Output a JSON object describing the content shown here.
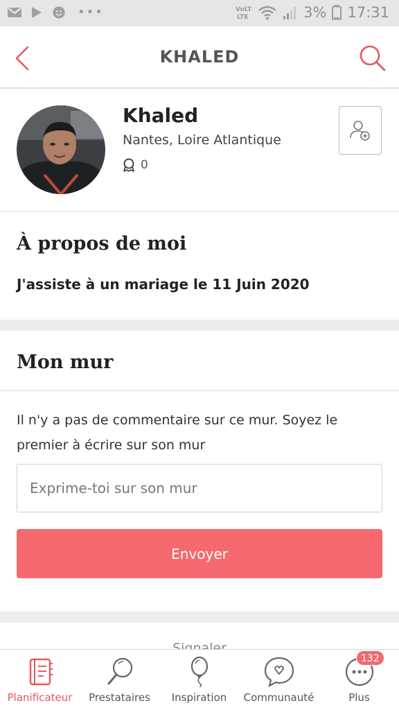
{
  "status_bar": {
    "battery": "3%",
    "time": "17:31",
    "icons": [
      "gmail-icon",
      "play-store-icon",
      "smiley-icon",
      "more-dots-icon",
      "volte-icon",
      "wifi-icon",
      "signal-icon",
      "battery-icon"
    ]
  },
  "header": {
    "title": "KHALED",
    "back_icon": "chevron-left-icon",
    "search_icon": "search-icon",
    "accent_color": "#e8585e"
  },
  "profile": {
    "name": "Khaled",
    "location": "Nantes, Loire Atlantique",
    "badge_count": "0",
    "badge_icon": "award-icon",
    "add_friend_icon": "add-user-icon"
  },
  "about": {
    "heading": "À propos de moi",
    "text": "J'assiste à un mariage le 11 Juin 2020"
  },
  "wall": {
    "heading": "Mon mur",
    "empty_message": "Il n'y a pas de commentaire sur ce mur. Soyez le premier à écrire sur son mur",
    "input_placeholder": "Exprime-toi sur son mur",
    "send_label": "Envoyer",
    "send_color": "#f46a6f"
  },
  "partial_section": {
    "text": "Signaler"
  },
  "bottom_nav": {
    "items": [
      {
        "label": "Planificateur",
        "icon": "planner-book-icon",
        "active": true
      },
      {
        "label": "Prestataires",
        "icon": "magnifier-icon",
        "active": false
      },
      {
        "label": "Inspiration",
        "icon": "balloon-icon",
        "active": false
      },
      {
        "label": "Communauté",
        "icon": "chat-heart-icon",
        "active": false
      },
      {
        "label": "Plus",
        "icon": "more-icon",
        "active": false
      }
    ],
    "plus_badge": "132"
  }
}
